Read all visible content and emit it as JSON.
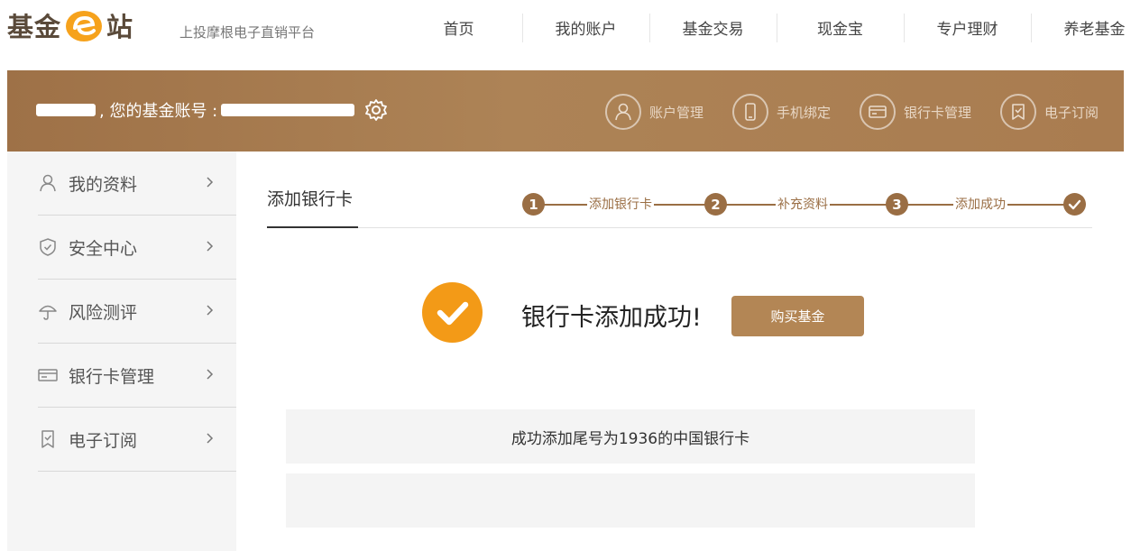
{
  "header": {
    "logo": {
      "left": "基金",
      "right": "站"
    },
    "slogan": "上投摩根电子直销平台",
    "nav": [
      "首页",
      "我的账户",
      "基金交易",
      "现金宝",
      "专户理财",
      "养老基金"
    ]
  },
  "banner": {
    "greeting": ", 您的基金账号 :",
    "menu": [
      {
        "label": "账户管理",
        "icon": "user-icon"
      },
      {
        "label": "手机绑定",
        "icon": "phone-icon"
      },
      {
        "label": "银行卡管理",
        "icon": "card-icon"
      },
      {
        "label": "电子订阅",
        "icon": "subscribe-icon"
      }
    ]
  },
  "sidebar": {
    "items": [
      {
        "label": "我的资料",
        "icon": "user-icon"
      },
      {
        "label": "安全中心",
        "icon": "shield-icon"
      },
      {
        "label": "风险测评",
        "icon": "umbrella-icon"
      },
      {
        "label": "银行卡管理",
        "icon": "card-icon"
      },
      {
        "label": "电子订阅",
        "icon": "subscribe-icon"
      }
    ]
  },
  "main": {
    "tab": "添加银行卡",
    "steps": [
      {
        "num": "1",
        "label": "添加银行卡"
      },
      {
        "num": "2",
        "label": "补充资料"
      },
      {
        "num": "3",
        "label": "添加成功"
      }
    ],
    "success_text": "银行卡添加成功!",
    "buy_button": "购买基金",
    "info_message": "成功添加尾号为1936的中国银行卡"
  },
  "colors": {
    "brand_brown": "#a97c50",
    "accent_orange": "#f39a17",
    "button_brown": "#b38655"
  }
}
